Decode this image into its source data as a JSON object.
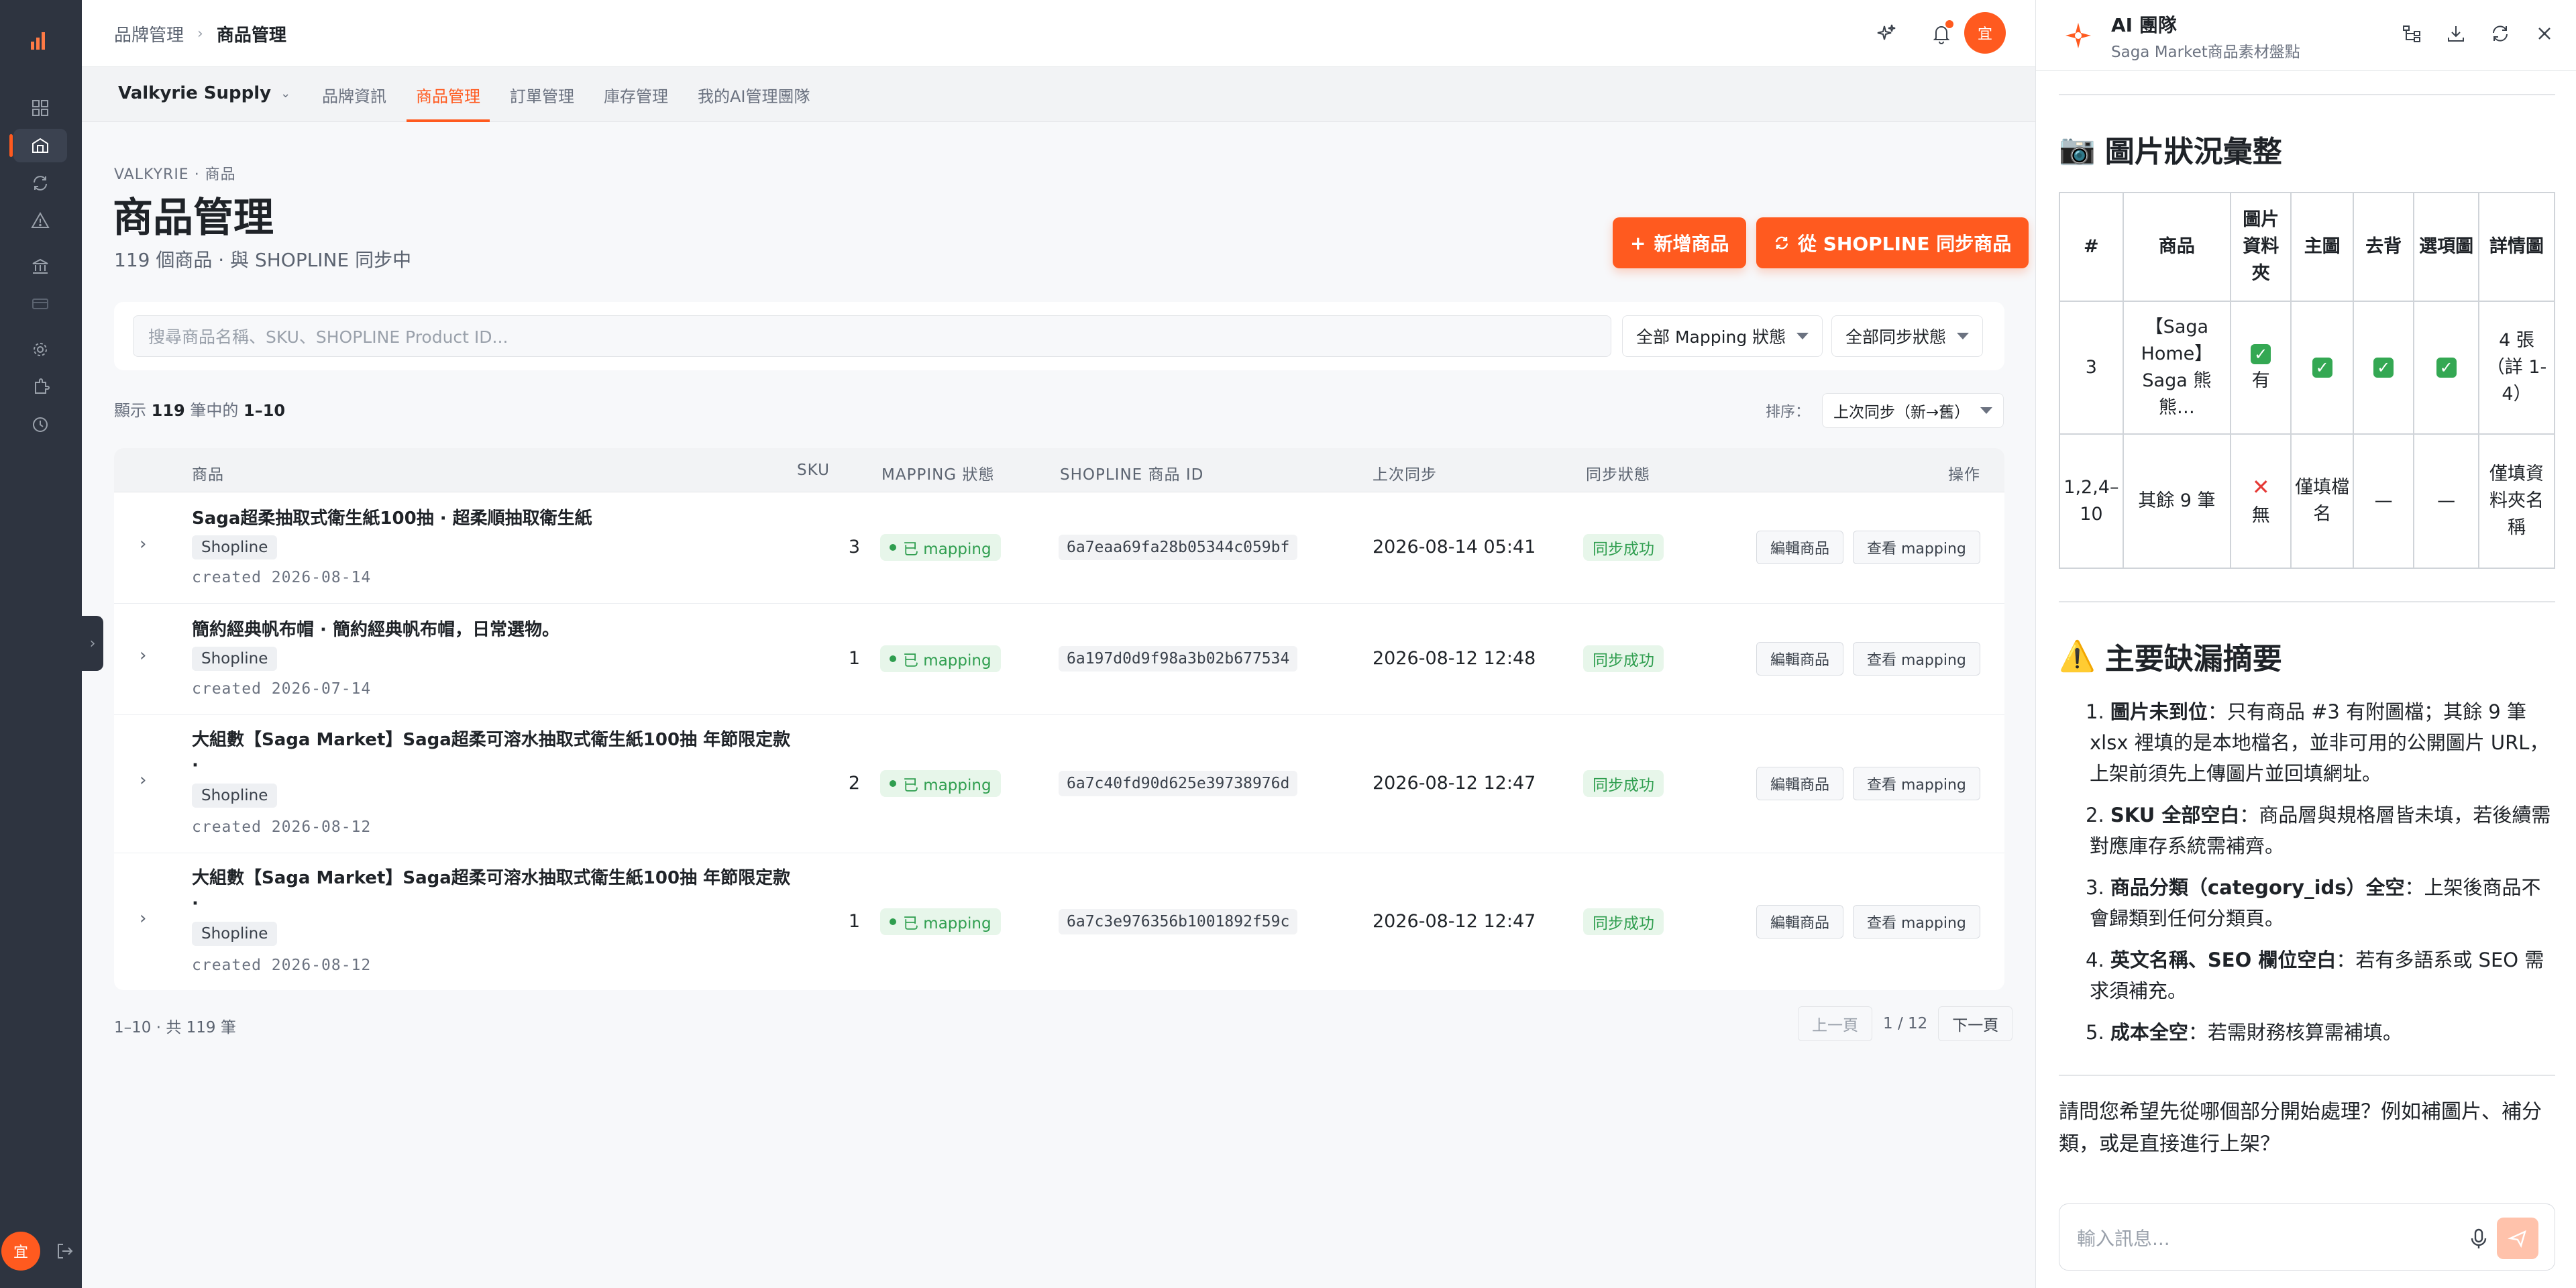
{
  "breadcrumb": {
    "parent": "品牌管理",
    "current": "商品管理"
  },
  "topbar": {
    "avatar_text": "宜"
  },
  "subnav": {
    "org": "Valkyrie Supply",
    "tabs": [
      "品牌資訊",
      "商品管理",
      "訂單管理",
      "庫存管理",
      "我的AI管理團隊"
    ],
    "active_tab": "商品管理"
  },
  "page": {
    "eyebrow": "VALKYRIE · 商品",
    "title": "商品管理",
    "subtitle": "119 個商品 · 與 SHOPLINE 同步中",
    "btn_new": "新增商品",
    "btn_sync": "從 SHOPLINE 同步商品"
  },
  "filters": {
    "search_placeholder": "搜尋商品名稱、SKU、SHOPLINE Product ID...",
    "mapping_select": "全部 Mapping 狀態",
    "sync_select": "全部同步狀態"
  },
  "count": {
    "prefix": "顯示",
    "total": "119",
    "mid": "筆中的",
    "range": "1–10"
  },
  "sort": {
    "label": "排序：",
    "value": "上次同步（新→舊）"
  },
  "table": {
    "headers": {
      "product": "商品",
      "sku": "SKU",
      "mapping": "MAPPING 狀態",
      "pid": "SHOPLINE 商品 ID",
      "last": "上次同步",
      "status": "同步狀態",
      "actions": "操作"
    },
    "rows": [
      {
        "name": "Saga超柔抽取式衛生紙100抽 · 超柔順抽取衛生紙",
        "chip": "Shopline",
        "created": "created 2026-08-14",
        "sku": "3",
        "mapping": "已 mapping",
        "pid": "6a7eaa69fa28b05344c059bf",
        "last": "2026-08-14 05:41",
        "status": "同步成功",
        "edit": "編輯商品",
        "view": "查看 mapping"
      },
      {
        "name": "簡約經典帆布帽 · 簡約經典帆布帽，日常選物。",
        "chip": "Shopline",
        "created": "created 2026-07-14",
        "sku": "1",
        "mapping": "已 mapping",
        "pid": "6a197d0d9f98a3b02b677534",
        "last": "2026-08-12 12:48",
        "status": "同步成功",
        "edit": "編輯商品",
        "view": "查看 mapping"
      },
      {
        "name": "大組數【Saga Market】Saga超柔可溶水抽取式衛生紙100抽 年節限定款 ·",
        "chip": "Shopline",
        "created": "created 2026-08-12",
        "sku": "2",
        "mapping": "已 mapping",
        "pid": "6a7c40fd90d625e39738976d",
        "last": "2026-08-12 12:47",
        "status": "同步成功",
        "edit": "編輯商品",
        "view": "查看 mapping"
      },
      {
        "name": "大組數【Saga Market】Saga超柔可溶水抽取式衛生紙100抽 年節限定款 ·",
        "chip": "Shopline",
        "created": "created 2026-08-12",
        "sku": "1",
        "mapping": "已 mapping",
        "pid": "6a7c3e976356b1001892f59c",
        "last": "2026-08-12 12:47",
        "status": "同步成功",
        "edit": "編輯商品",
        "view": "查看 mapping"
      }
    ]
  },
  "footer": {
    "range": "1–10 · 共 119 筆",
    "prev": "上一頁",
    "page": "1 / 12",
    "next": "下一頁"
  },
  "panel": {
    "title": "AI 團隊",
    "subtitle": "Saga Market商品素材盤點",
    "section1": {
      "emoji": "📷",
      "title": "圖片狀況彙整"
    },
    "table_headers": [
      "#",
      "商品",
      "圖片資料夾",
      "主圖",
      "去背",
      "選項圖",
      "詳情圖"
    ],
    "table_rows": [
      [
        "3",
        "【Saga Home】Saga 熊熊…",
        "有",
        "",
        "",
        "",
        "4 張（詳 1-4）"
      ],
      [
        "1,2,4–10",
        "其餘 9 筆",
        "無",
        "僅填檔名",
        "—",
        "—",
        "僅填資料夾名稱"
      ]
    ],
    "section2": {
      "emoji": "⚠️",
      "title": "主要缺漏摘要"
    },
    "items": [
      {
        "num": "1.",
        "bold": "圖片未到位",
        "text": "：只有商品 #3 有附圖檔；其餘 9 筆 xlsx 裡填的是本地檔名，並非可用的公開圖片 URL，上架前須先上傳圖片並回填網址。"
      },
      {
        "num": "2.",
        "bold": "SKU 全部空白",
        "text": "：商品層與規格層皆未填，若後續需對應庫存系統需補齊。"
      },
      {
        "num": "3.",
        "bold": "商品分類（category_ids）全空",
        "text": "：上架後商品不會歸類到任何分類頁。"
      },
      {
        "num": "4.",
        "bold": "英文名稱、SEO 欄位空白",
        "text": "：若有多語系或 SEO 需求須補充。"
      },
      {
        "num": "5.",
        "bold": "成本全空",
        "text": "：若需財務核算需補填。"
      }
    ],
    "question": "請問您希望先從哪個部分開始處理？例如補圖片、補分類，或是直接進行上架？",
    "composer_placeholder": "輸入訊息..."
  },
  "colors": {
    "accent": "#ff5a1f",
    "rail": "#2e3440",
    "success": "#2f9e4f"
  }
}
